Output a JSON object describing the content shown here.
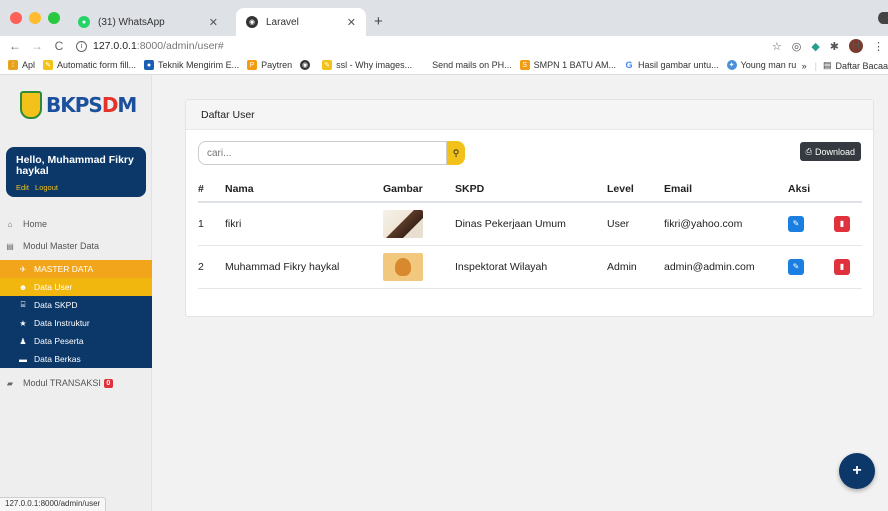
{
  "browser": {
    "tabs": [
      {
        "title": "(31) WhatsApp",
        "icon": "whatsapp-icon",
        "color": "#25d366"
      },
      {
        "title": "Laravel",
        "icon": "globe-icon",
        "color": "#333333"
      }
    ],
    "url_host": "127.0.0.1",
    "url_path": ":8000/admin/user#",
    "bookmarks": [
      {
        "label": "Apl",
        "icon": "apps-icon",
        "color": "#e8a11c"
      },
      {
        "label": "Automatic form fill...",
        "icon": "form-icon",
        "color": "#f2c21a"
      },
      {
        "label": "Teknik Mengirim E...",
        "icon": "bookmark-icon",
        "color": "#1a5fb4"
      },
      {
        "label": "Paytren",
        "icon": "paytren-icon",
        "color": "#f39c12"
      },
      {
        "label": "",
        "icon": "globe-icon",
        "color": "#333333"
      },
      {
        "label": "ssl - Why images...",
        "icon": "ssl-icon",
        "color": "#f2c21a"
      },
      {
        "label": "Send mails on PH...",
        "icon": "",
        "color": ""
      },
      {
        "label": "SMPN 1 BATU AM...",
        "icon": "school-icon",
        "color": "#f39c12"
      },
      {
        "label": "Hasil gambar untu...",
        "icon": "google-icon",
        "color": "#4285f4"
      },
      {
        "label": "Young man runner...",
        "icon": "runner-icon",
        "color": "#4a90d9"
      }
    ],
    "bookmarks_more": "»",
    "reading_list": "Daftar Bacaa"
  },
  "sidebar": {
    "user_greeting": "Hello, Muhammad Fikry haykal",
    "edit_label": "Edit",
    "logout_label": "Logout",
    "home_label": "Home",
    "module_master_label": "Modul Master Data",
    "master_data_label": "MASTER DATA",
    "items": [
      {
        "label": "Data User",
        "icon": "users-icon"
      },
      {
        "label": "Data SKPD",
        "icon": "bank-icon"
      },
      {
        "label": "Data Instruktur",
        "icon": "star-icon"
      },
      {
        "label": "Data Peserta",
        "icon": "user-icon"
      },
      {
        "label": "Data Berkas",
        "icon": "folder-icon"
      }
    ],
    "module_transaksi_label": "Modul TRANSAKSI",
    "transaksi_badge": "0"
  },
  "main": {
    "card_title": "Daftar User",
    "search_placeholder": "cari...",
    "download_label": "Download",
    "columns": [
      "#",
      "Nama",
      "Gambar",
      "SKPD",
      "Level",
      "Email",
      "Aksi"
    ],
    "rows": [
      {
        "no": "1",
        "nama": "fikri",
        "skpd": "Dinas Pekerjaan Umum",
        "level": "User",
        "email": "fikri@yahoo.com"
      },
      {
        "no": "2",
        "nama": "Muhammad Fikry haykal",
        "skpd": "Inspektorat Wilayah",
        "level": "Admin",
        "email": "admin@admin.com"
      }
    ]
  },
  "status_url": "127.0.0.1:8000/admin/user",
  "colors": {
    "navy": "#0b3769",
    "accent_yellow": "#f2c21a",
    "edit_blue": "#1a7fe0",
    "delete_red": "#e0323c"
  }
}
